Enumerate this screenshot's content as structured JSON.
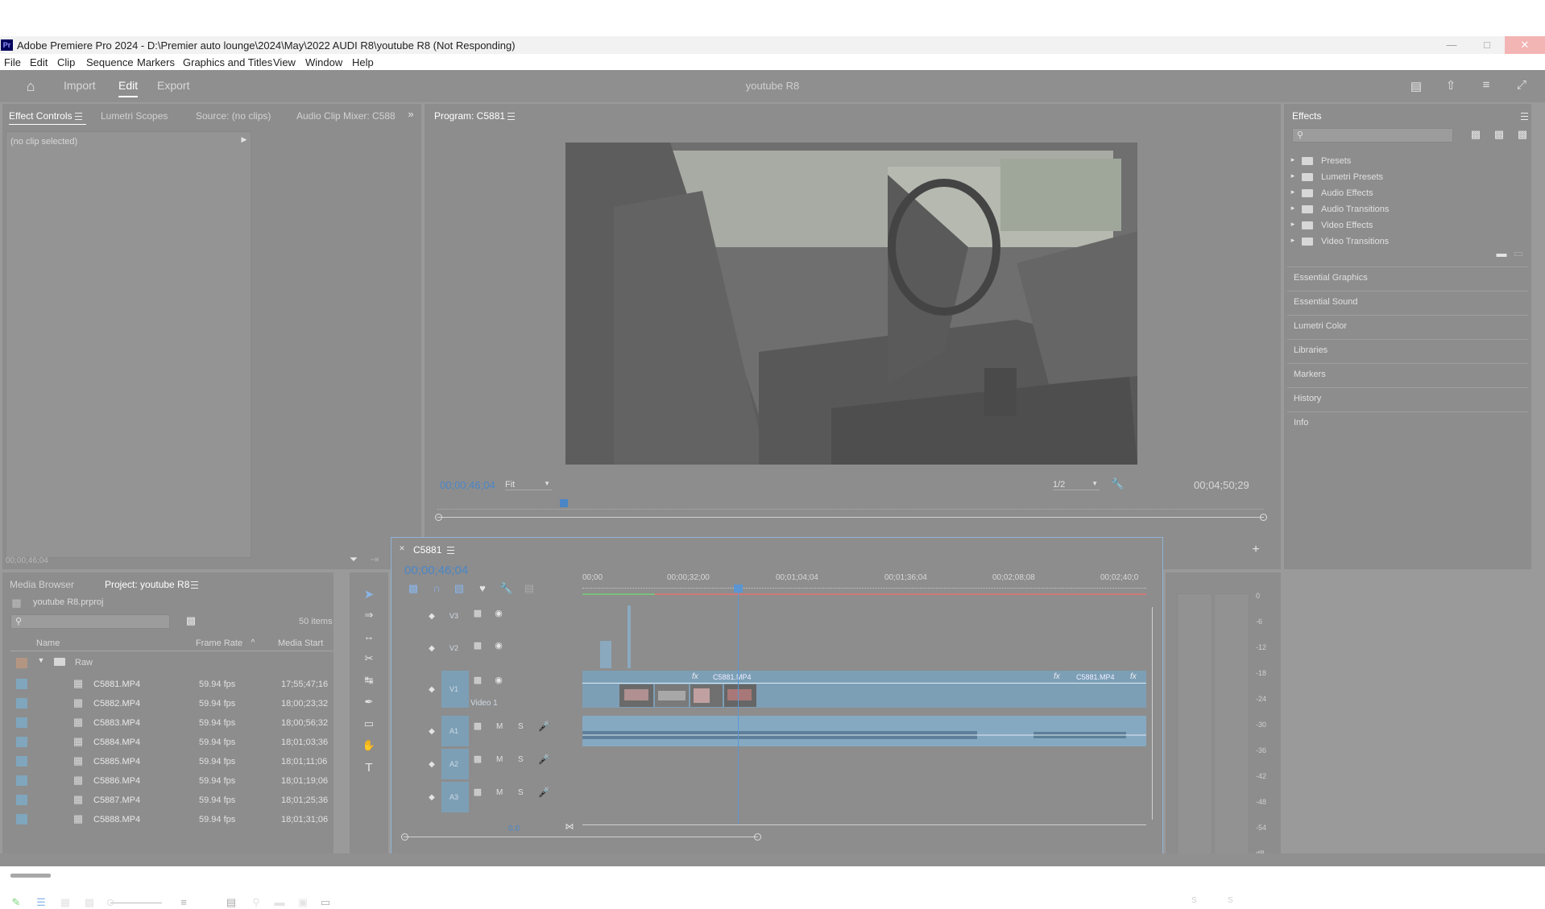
{
  "window": {
    "title": "Adobe Premiere Pro 2024 - D:\\Premier auto lounge\\2024\\May\\2022 AUDI R8\\youtube R8 (Not Responding)",
    "app_icon": "Pr"
  },
  "menu": [
    "File",
    "Edit",
    "Clip",
    "Sequence",
    "Markers",
    "Graphics and Titles",
    "View",
    "Window",
    "Help"
  ],
  "header": {
    "workspaces": [
      "Import",
      "Edit",
      "Export"
    ],
    "active_workspace": "Edit",
    "project_name": "youtube R8"
  },
  "source_panel": {
    "tabs": [
      "Effect Controls",
      "Lumetri Scopes",
      "Source: (no clips)",
      "Audio Clip Mixer: C588"
    ],
    "active_tab": "Effect Controls",
    "no_clip": "(no clip selected)",
    "timecode": "00;00;46;04"
  },
  "program": {
    "title": "Program: C5881",
    "timecode": "00;00;46;04",
    "fit": "Fit",
    "resolution": "1/2",
    "duration": "00;04;50;29"
  },
  "effects": {
    "title": "Effects",
    "folders": [
      "Presets",
      "Lumetri Presets",
      "Audio Effects",
      "Audio Transitions",
      "Video Effects",
      "Video Transitions"
    ],
    "panels": [
      "Essential Graphics",
      "Essential Sound",
      "Lumetri Color",
      "Libraries",
      "Markers",
      "History",
      "Info"
    ]
  },
  "project": {
    "tabs": [
      "Media Browser",
      "Project: youtube R8"
    ],
    "active_tab": "Project: youtube R8",
    "file": "youtube R8.prproj",
    "items_count": "50 items",
    "columns": [
      "Name",
      "Frame Rate",
      "Media Start"
    ],
    "bin": "Raw",
    "clips": [
      {
        "name": "C5881.MP4",
        "fps": "59.94 fps",
        "start": "17;55;47;16"
      },
      {
        "name": "C5882.MP4",
        "fps": "59.94 fps",
        "start": "18;00;23;32"
      },
      {
        "name": "C5883.MP4",
        "fps": "59.94 fps",
        "start": "18;00;56;32"
      },
      {
        "name": "C5884.MP4",
        "fps": "59.94 fps",
        "start": "18;01;03;36"
      },
      {
        "name": "C5885.MP4",
        "fps": "59.94 fps",
        "start": "18;01;11;06"
      },
      {
        "name": "C5886.MP4",
        "fps": "59.94 fps",
        "start": "18;01;19;06"
      },
      {
        "name": "C5887.MP4",
        "fps": "59.94 fps",
        "start": "18;01;25;36"
      },
      {
        "name": "C5888.MP4",
        "fps": "59.94 fps",
        "start": "18;01;31;06"
      }
    ]
  },
  "timeline": {
    "sequence": "C5881",
    "timecode": "00;00;46;04",
    "ruler": [
      "00;00",
      "00;00;32;00",
      "00;01;04;04",
      "00;01;36;04",
      "00;02;08;08",
      "00;02;40;0"
    ],
    "video_tracks": [
      "V3",
      "V2",
      "V1"
    ],
    "v1_name": "Video 1",
    "audio_tracks": [
      "A1",
      "A2",
      "A3"
    ],
    "clip_labels": [
      "C5881.MP4",
      "C5881.MP4"
    ],
    "mix_value": "0.0",
    "track_buttons": {
      "mute": "M",
      "solo": "S"
    }
  },
  "meter": {
    "scale": [
      "0",
      "-6",
      "-12",
      "-18",
      "-24",
      "-30",
      "-36",
      "-42",
      "-48",
      "-54",
      "dB"
    ],
    "buttons": [
      "S",
      "S"
    ]
  }
}
